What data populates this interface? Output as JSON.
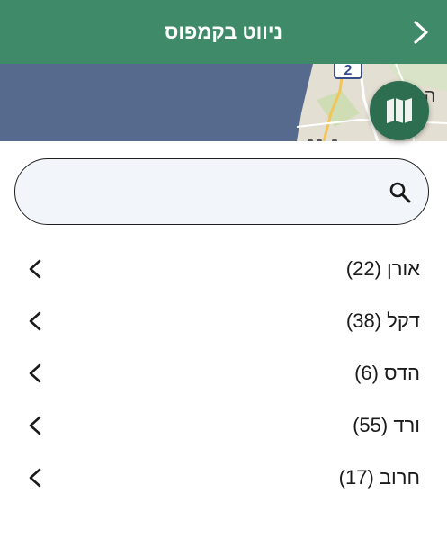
{
  "header": {
    "title": "ניווט בקמפוס",
    "back_icon": "chevron-right-icon"
  },
  "map": {
    "road_shield": "2",
    "map_label": "ה",
    "map_button_icon": "map-icon"
  },
  "search": {
    "value": "",
    "placeholder": "",
    "icon": "search-icon"
  },
  "list": {
    "items": [
      {
        "label": "אורן (22)"
      },
      {
        "label": "דקל (38)"
      },
      {
        "label": "הדס (6)"
      },
      {
        "label": "ורד (55)"
      },
      {
        "label": "חרוב (17)"
      }
    ]
  },
  "colors": {
    "header_bg": "#3f8a68",
    "map_water": "#566a8e",
    "map_button": "#2e6e50",
    "search_bg": "#f2f5f9"
  }
}
